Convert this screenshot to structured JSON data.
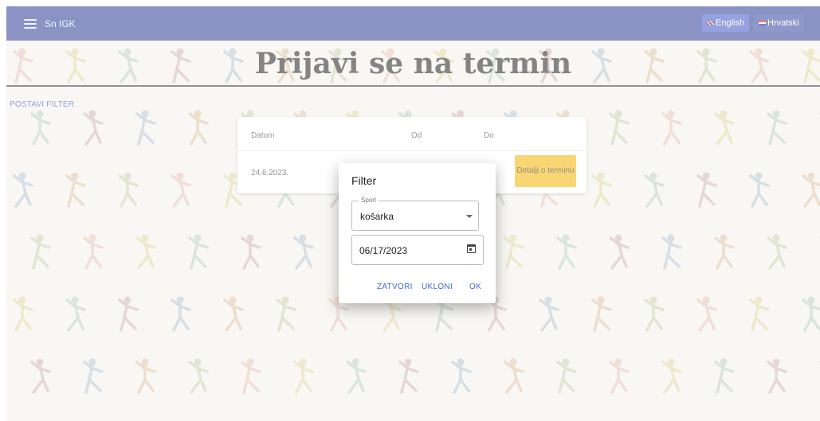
{
  "appbar": {
    "brand": "Sn IGK",
    "languages": [
      {
        "label": "English",
        "flag": "uk-flag-icon"
      },
      {
        "label": "Hrvatski",
        "flag": "croatia-flag-icon"
      }
    ]
  },
  "page": {
    "title": "Prijavi se na termin",
    "filter_link": "POSTAVI FILTER"
  },
  "table": {
    "columns": [
      "Datum",
      "Od",
      "Do"
    ],
    "rows": [
      {
        "datum": "24.6.2023.",
        "od": "",
        "do": "",
        "action": "Detalji o terminu"
      }
    ]
  },
  "dialog": {
    "title": "Filter",
    "sport": {
      "label": "Sport",
      "value": "košarka"
    },
    "date": {
      "value": "06/17/2023"
    },
    "buttons": {
      "close": "ZATVORI",
      "remove": "UKLONI",
      "ok": "OK"
    }
  },
  "colors": {
    "appbar": "#2b3b94",
    "accent_button": "#f0b400",
    "dialog_action": "#3a6bd6",
    "page_background": "#f3f0ea"
  }
}
